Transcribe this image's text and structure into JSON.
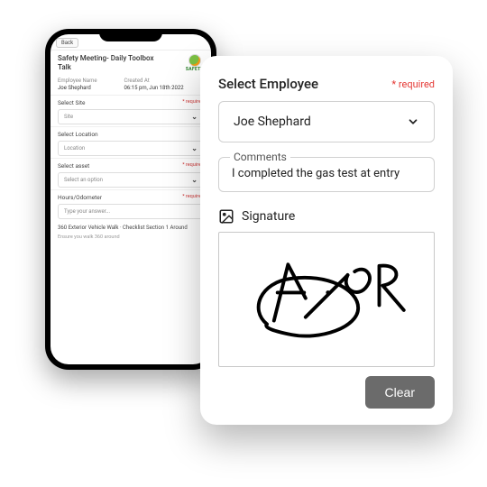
{
  "phone": {
    "back": "Back",
    "title": "Safety Meeting- Daily Toolbox Talk",
    "logo_text": "SAFETY",
    "meta": {
      "name_label": "Employee Name",
      "name_value": "Joe Shephard",
      "created_label": "Created At",
      "created_value": "06:15 pm, Jun 18th 2022"
    },
    "site": {
      "label": "Select Site",
      "placeholder": "Site",
      "required": "* required"
    },
    "location": {
      "label": "Select Location",
      "placeholder": "Location"
    },
    "asset": {
      "label": "Select asset",
      "placeholder": "Select an option",
      "required": "* required"
    },
    "hours": {
      "label": "Hours/Odometer",
      "placeholder": "Type your answer...",
      "required": "* required"
    },
    "walk": {
      "title": "360 Exterior Vehicle Walk · Checklist Section 1 Around",
      "note": "Ensure you walk 360 around"
    }
  },
  "card": {
    "heading": "Select Employee",
    "required": "* required",
    "employee": "Joe Shephard",
    "comments_label": "Comments",
    "comments_value": "I completed the gas test at entry",
    "signature_label": "Signature",
    "clear": "Clear"
  }
}
